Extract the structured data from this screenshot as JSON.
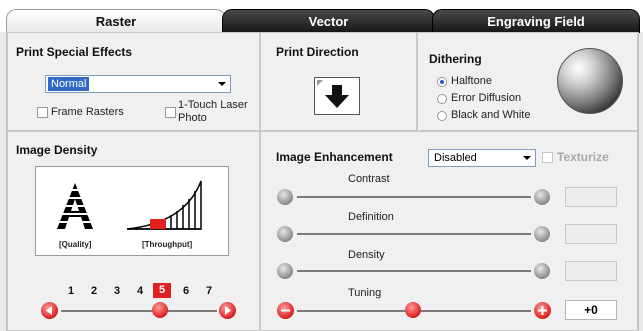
{
  "tabs": [
    {
      "label": "Raster",
      "active": true
    },
    {
      "label": "Vector",
      "active": false
    },
    {
      "label": "Engraving Field",
      "active": false
    }
  ],
  "print_special_effects": {
    "title": "Print Special Effects",
    "mode_select": {
      "value": "Normal"
    },
    "frame_rasters": {
      "label": "Frame Rasters",
      "checked": false
    },
    "one_touch": {
      "label_line1": "1-Touch Laser",
      "label_line2": "Photo",
      "checked": false
    }
  },
  "print_direction": {
    "title": "Print Direction",
    "icon": "down-arrow-icon"
  },
  "dithering": {
    "title": "Dithering",
    "options": [
      {
        "label": "Halftone",
        "selected": true
      },
      {
        "label": "Error Diffusion",
        "selected": false
      },
      {
        "label": "Black and White",
        "selected": false
      }
    ]
  },
  "image_density": {
    "title": "Image Density",
    "quality_label": "[Quality]",
    "throughput_label": "[Throughput]",
    "levels": [
      "1",
      "2",
      "3",
      "4",
      "5",
      "6",
      "7"
    ],
    "selected_level": "5",
    "selected_color": "#e02020"
  },
  "image_enhancement": {
    "title": "Image Enhancement",
    "mode_select": {
      "value": "Disabled"
    },
    "texturize": {
      "label": "Texturize",
      "checked": false,
      "enabled": false
    },
    "sliders": [
      {
        "label": "Contrast",
        "value": ""
      },
      {
        "label": "Definition",
        "value": ""
      },
      {
        "label": "Density",
        "value": ""
      },
      {
        "label": "Tuning",
        "value": "+0"
      }
    ]
  }
}
